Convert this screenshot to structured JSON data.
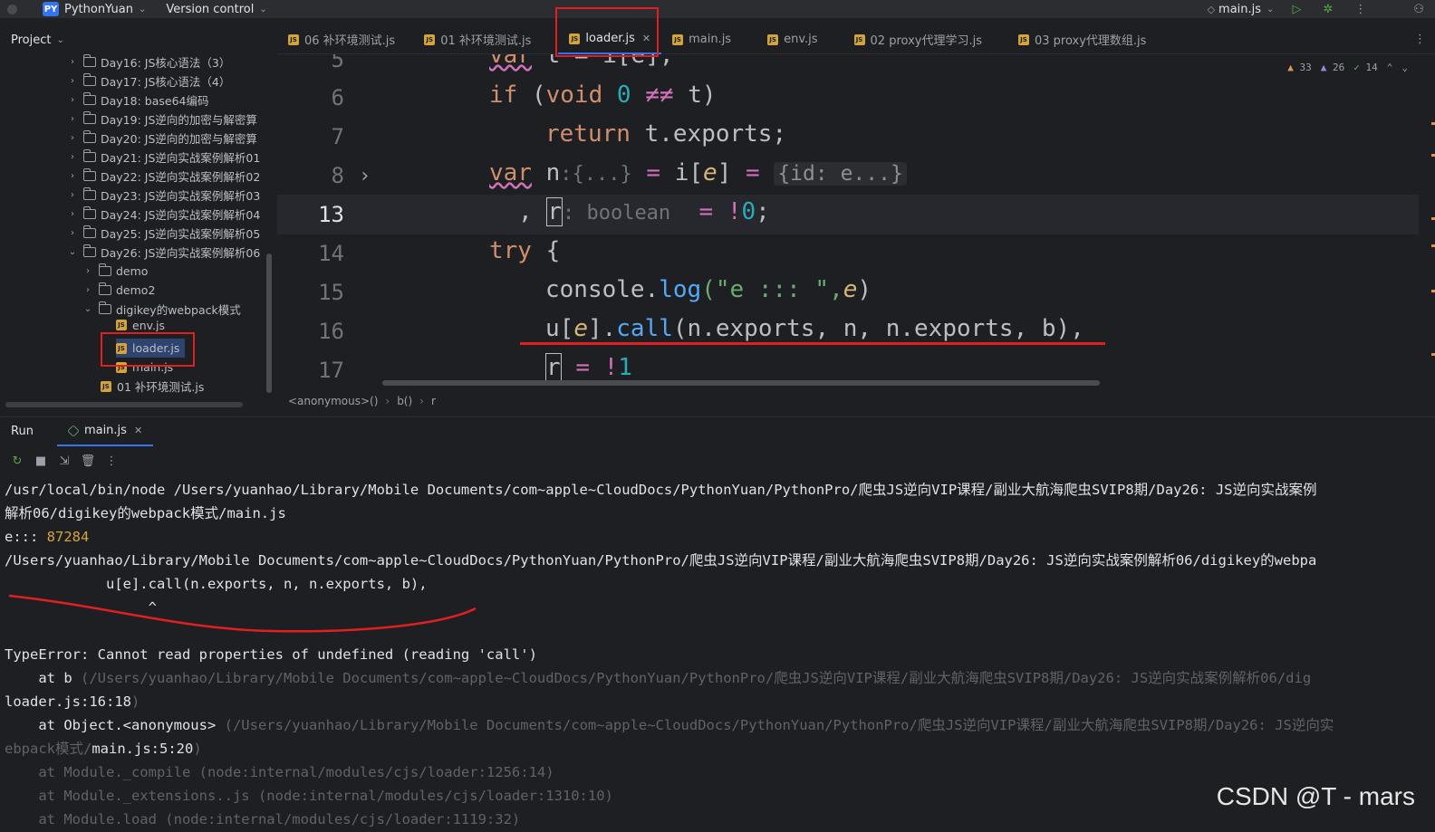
{
  "titlebar": {
    "project_badge": "PY",
    "project_name": "PythonYuan",
    "vcs": "Version control",
    "run_config": "main.js"
  },
  "project_panel": {
    "title": "Project"
  },
  "tabs": [
    {
      "label": "06 补环境测试.js",
      "active": false
    },
    {
      "label": "01 补环境测试.js",
      "active": false
    },
    {
      "label": "loader.js",
      "active": true
    },
    {
      "label": "main.js",
      "active": false
    },
    {
      "label": "env.js",
      "active": false
    },
    {
      "label": "02 proxy代理学习.js",
      "active": false
    },
    {
      "label": "03 proxy代理数组.js",
      "active": false
    }
  ],
  "tree": [
    {
      "label": "Day16: JS核心语法（3）",
      "type": "folder",
      "expanded": false
    },
    {
      "label": "Day17: JS核心语法（4）",
      "type": "folder",
      "expanded": false
    },
    {
      "label": "Day18: base64编码",
      "type": "folder",
      "expanded": false
    },
    {
      "label": "Day19: JS逆向的加密与解密算",
      "type": "folder",
      "expanded": false
    },
    {
      "label": "Day20: JS逆向的加密与解密算",
      "type": "folder",
      "expanded": false
    },
    {
      "label": "Day21: JS逆向实战案例解析01",
      "type": "folder",
      "expanded": false
    },
    {
      "label": "Day22: JS逆向实战案例解析02",
      "type": "folder",
      "expanded": false
    },
    {
      "label": "Day23: JS逆向实战案例解析03",
      "type": "folder",
      "expanded": false
    },
    {
      "label": "Day24: JS逆向实战案例解析04",
      "type": "folder",
      "expanded": false
    },
    {
      "label": "Day25: JS逆向实战案例解析05",
      "type": "folder",
      "expanded": false
    },
    {
      "label": "Day26: JS逆向实战案例解析06",
      "type": "folder",
      "expanded": true
    },
    {
      "label": "demo",
      "type": "folder",
      "expanded": false
    },
    {
      "label": "demo2",
      "type": "folder",
      "expanded": false
    },
    {
      "label": "digikey的webpack模式",
      "type": "folder",
      "expanded": true
    },
    {
      "label": "env.js",
      "type": "file"
    },
    {
      "label": "loader.js",
      "type": "file"
    },
    {
      "label": "main.js",
      "type": "file"
    },
    {
      "label": "01 补环境测试.js",
      "type": "file"
    }
  ],
  "editor": {
    "line_numbers": [
      "5",
      "6",
      "7",
      "8",
      "13",
      "14",
      "15",
      "16",
      "17"
    ],
    "current_line": "13",
    "inspections": {
      "warnings": "33",
      "weak_warnings": "26",
      "ok": "14"
    },
    "code": {
      "l5": [
        "var",
        "t = i[e];"
      ],
      "l6": [
        "if",
        "(",
        "void",
        "0",
        "≠≠",
        "t)"
      ],
      "l7": [
        "return",
        "t.exports;"
      ],
      "l8": [
        "var",
        "n",
        ":{...}",
        "=",
        "i[",
        "e",
        "]",
        "=",
        "{id: e...}"
      ],
      "l13": [
        ",",
        "r",
        ": boolean",
        "=",
        "!",
        "0",
        ";"
      ],
      "l14": [
        "try",
        "{"
      ],
      "l15": [
        "console",
        ".",
        "log",
        "(\"e ::: \",",
        "e",
        ")"
      ],
      "l16": [
        "u[",
        "e",
        "].",
        "call",
        "(n.exports, n, n.exports, b),"
      ],
      "l17": [
        "r",
        "=",
        "!",
        "1"
      ]
    }
  },
  "breadcrumb": [
    "<anonymous>()",
    "b()",
    "r"
  ],
  "run_panel": {
    "label": "Run",
    "tab": "main.js"
  },
  "console": [
    {
      "text": "/usr/local/bin/node /Users/yuanhao/Library/Mobile Documents/com~apple~CloudDocs/PythonYuan/PythonPro/爬虫JS逆向VIP课程/副业大航海爬虫SVIP8期/Day26: JS逆向实战案例",
      "dim": false
    },
    {
      "text": "解析06/digikey的webpack模式/main.js",
      "dim": false
    },
    {
      "prefix": "e::: ",
      "value": "87284"
    },
    {
      "text": "/Users/yuanhao/Library/Mobile Documents/com~apple~CloudDocs/PythonYuan/PythonPro/爬虫JS逆向VIP课程/副业大航海爬虫SVIP8期/Day26: JS逆向实战案例解析06/digikey的webpa",
      "dim": false
    },
    {
      "text": "            u[e].call(n.exports, n, n.exports, b),",
      "dim": false
    },
    {
      "text": "                 ^",
      "dim": false
    },
    {
      "text": "",
      "dim": false
    },
    {
      "text": "TypeError: Cannot read properties of undefined (reading 'call')",
      "dim": false
    },
    {
      "prefix": "    at b ",
      "dimtext": "(/Users/yuanhao/Library/Mobile Documents/com~apple~CloudDocs/PythonYuan/PythonPro/爬虫JS逆向VIP课程/副业大航海爬虫SVIP8期/Day26: JS逆向实战案例解析06/dig"
    },
    {
      "prefix": "loader.js:16:18",
      "dimtext": ")"
    },
    {
      "prefix": "    at Object.<anonymous> ",
      "dimtext": "(/Users/yuanhao/Library/Mobile Documents/com~apple~CloudDocs/PythonYuan/PythonPro/爬虫JS逆向VIP课程/副业大航海爬虫SVIP8期/Day26: JS逆向实"
    },
    {
      "dimprefix": "ebpack模式/",
      "prefix": "main.js:5:20",
      "dimtext": ")"
    },
    {
      "text": "    at Module._compile (node:internal/modules/cjs/loader:1256:14)",
      "dim": true
    },
    {
      "text": "    at Module._extensions..js (node:internal/modules/cjs/loader:1310:10)",
      "dim": true
    },
    {
      "text": "    at Module.load (node:internal/modules/cjs/loader:1119:32)",
      "dim": true
    }
  ],
  "watermark": "CSDN @T - mars"
}
